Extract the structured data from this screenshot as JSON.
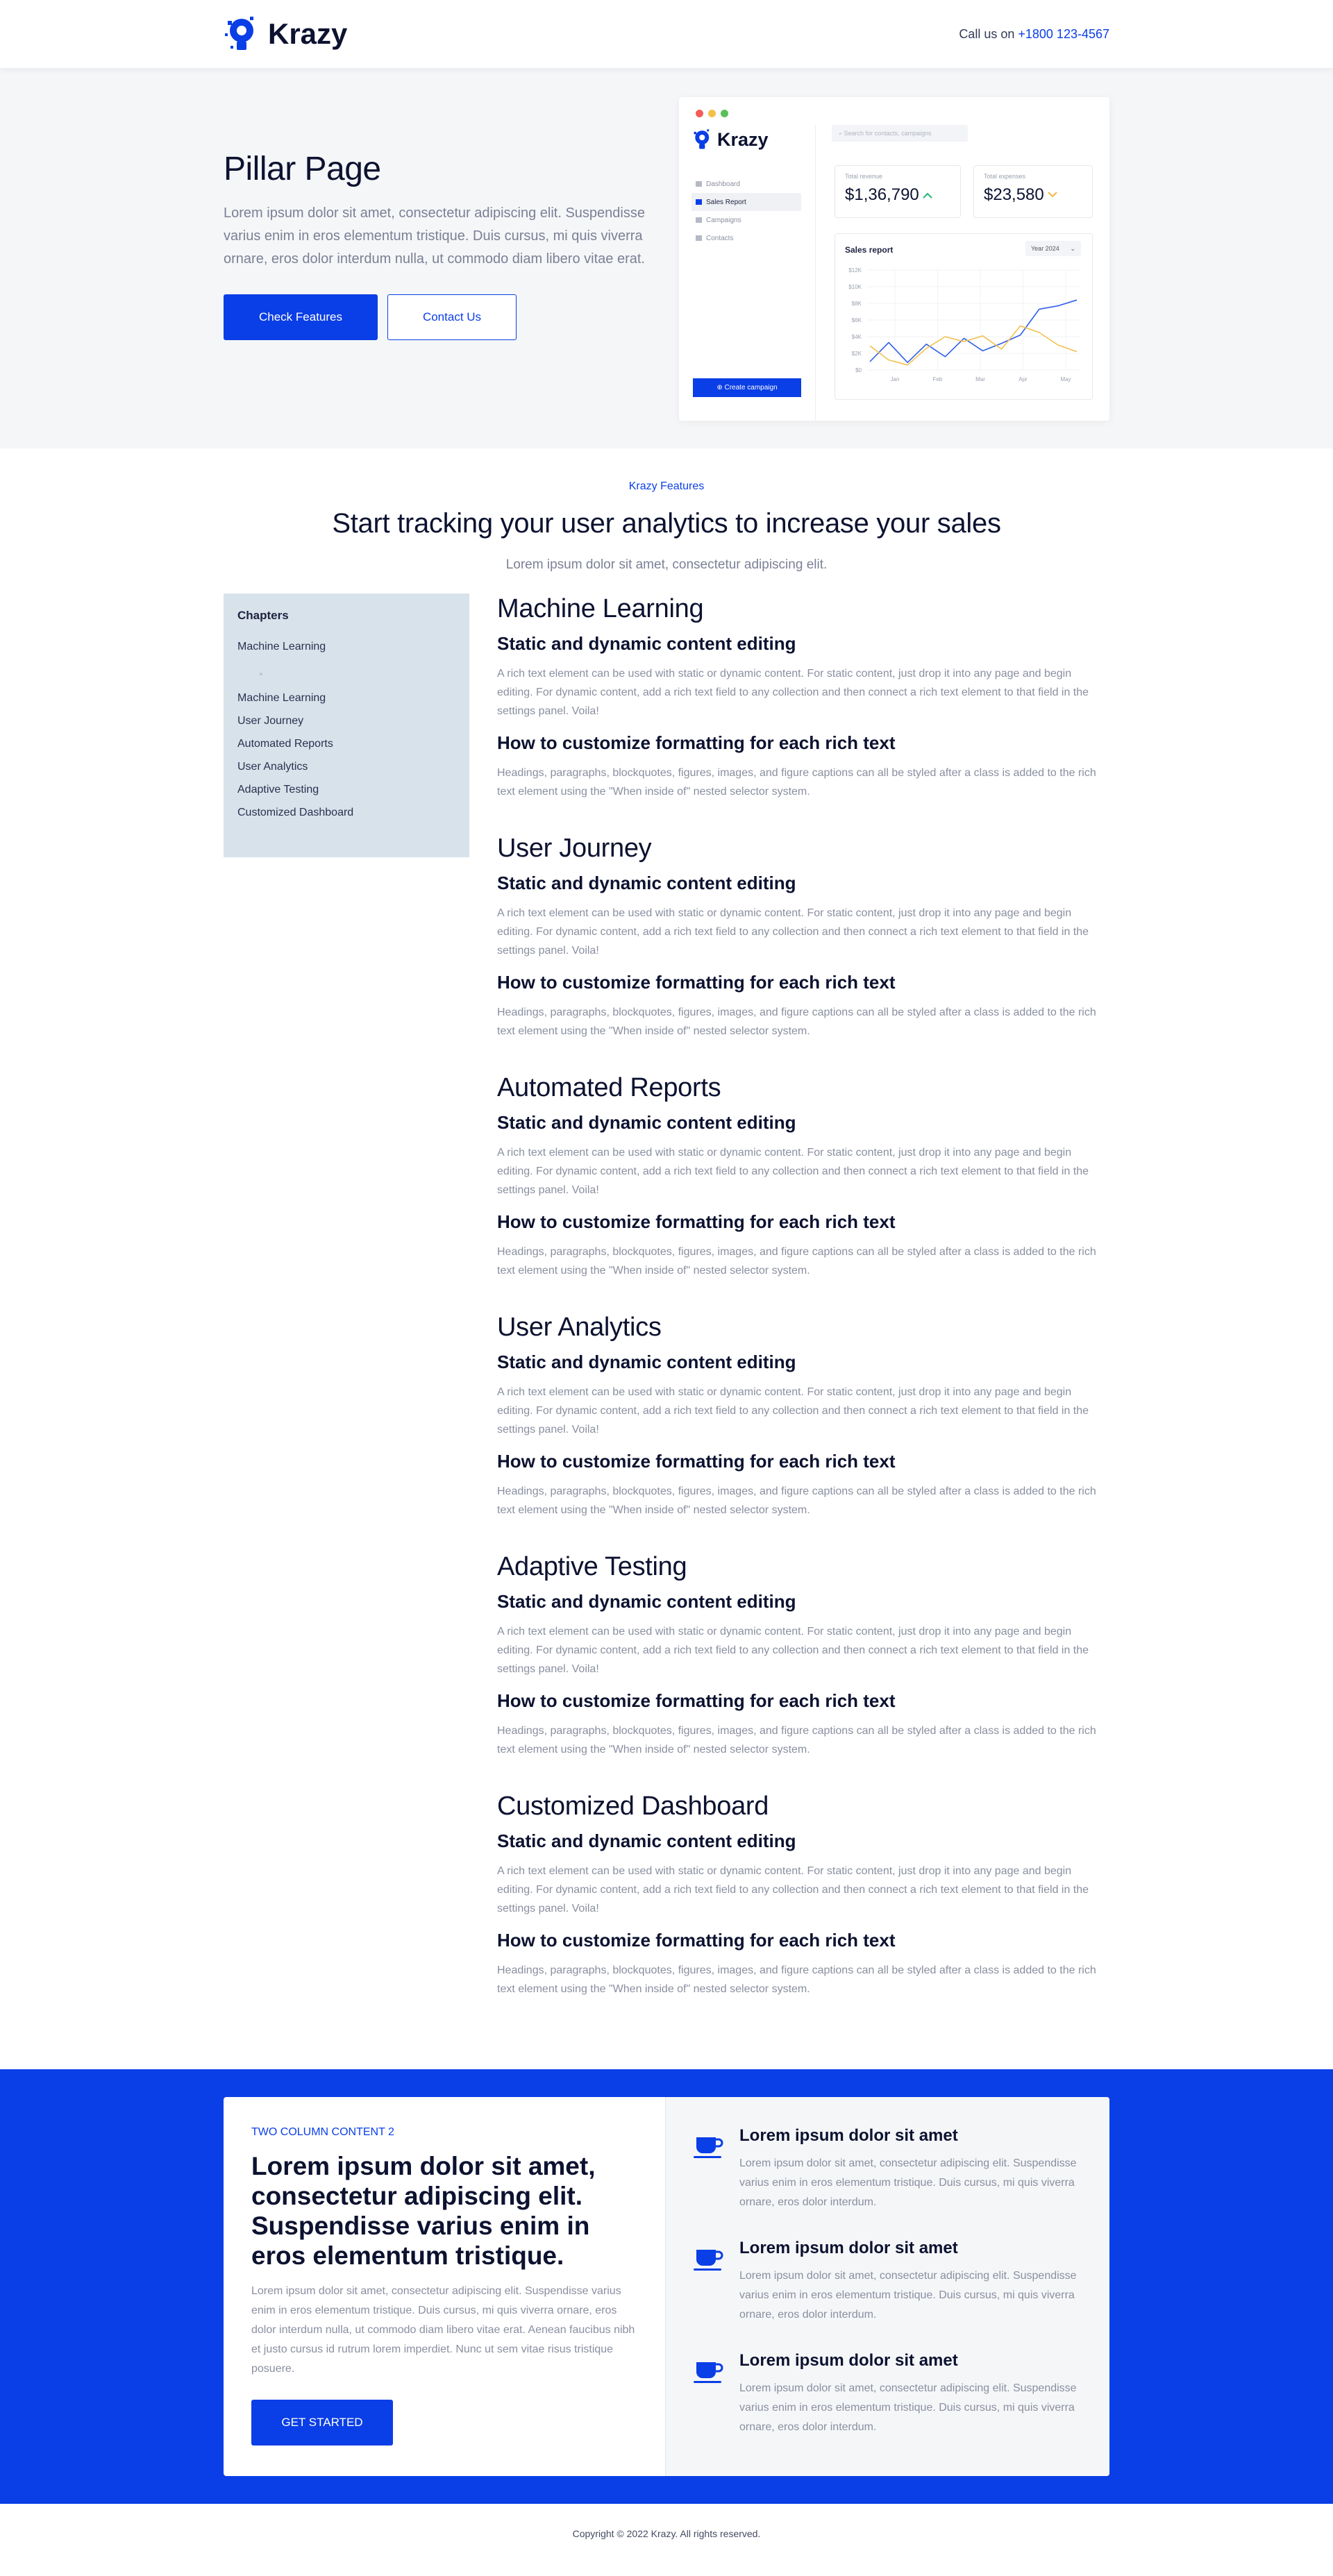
{
  "header": {
    "logo_text": "Krazy",
    "call_prefix": "Call us on",
    "phone": "+1800 123-4567"
  },
  "hero": {
    "title": "Pillar Page",
    "text": "Lorem ipsum dolor sit amet, consectetur adipiscing elit. Suspendisse varius enim in eros elementum tristique. Duis cursus, mi quis viverra ornare, eros dolor interdum nulla, ut commodo diam libero vitae erat.",
    "primary_button": "Check Features",
    "secondary_button": "Contact Us"
  },
  "dashboard_mockup": {
    "logo_text": "Krazy",
    "search_placeholder": "Search for contacts, campaigns",
    "nav": [
      {
        "label": "Dashboard",
        "active": false
      },
      {
        "label": "Sales Report",
        "active": true
      },
      {
        "label": "Campaigns",
        "active": false
      },
      {
        "label": "Contacts",
        "active": false
      }
    ],
    "cta": "Create campaign",
    "revenue_label": "Total revenue",
    "revenue_value": "$1,36,790",
    "expenses_label": "Total expenses",
    "expenses_value": "$23,580",
    "colors": {
      "up": "#22b573",
      "down": "#f2b840"
    }
  },
  "chart_data": {
    "type": "line",
    "title": "Sales report",
    "filter": "Year 2024",
    "x_labels": [
      "Jan",
      "Feb",
      "Mar",
      "Apr",
      "May"
    ],
    "y_ticks": [
      "$0",
      "$2K",
      "$4K",
      "$6K",
      "$8K",
      "$10K",
      "$12K"
    ],
    "ylim": [
      0,
      12
    ],
    "series": [
      {
        "color": "#2f5fe8",
        "values": [
          1.0,
          3.3,
          0.9,
          3.1,
          1.6,
          3.8,
          2.3,
          3.2,
          4.2,
          7.3,
          7.7,
          8.4
        ]
      },
      {
        "color": "#f2c14e",
        "values": [
          2.9,
          1.2,
          0.6,
          2.6,
          4.0,
          3.4,
          4.1,
          2.5,
          5.3,
          4.5,
          3.0,
          2.2
        ]
      }
    ]
  },
  "features": {
    "kicker": "Krazy Features",
    "title": "Start tracking your user analytics to increase your sales",
    "subtitle": "Lorem ipsum dolor sit amet, consectetur adipiscing elit."
  },
  "toc": {
    "title": "Chapters",
    "items": [
      "Machine Learning",
      "Machine Learning",
      "User Journey",
      "Automated Reports",
      "User Analytics",
      "Adaptive Testing",
      "Customized Dashboard"
    ]
  },
  "sections": [
    {
      "title": "Machine Learning",
      "h1": "Static and dynamic content editing",
      "p1": "A rich text element can be used with static or dynamic content. For static content, just drop it into any page and begin editing. For dynamic content, add a rich text field to any collection and then connect a rich text element to that field in the settings panel. Voila!",
      "h2": "How to customize formatting for each rich text",
      "p2": "Headings, paragraphs, blockquotes, figures, images, and figure captions can all be styled after a class is added to the rich text element using the \"When inside of\" nested selector system."
    },
    {
      "title": "User Journey",
      "h1": "Static and dynamic content editing",
      "p1": "A rich text element can be used with static or dynamic content. For static content, just drop it into any page and begin editing. For dynamic content, add a rich text field to any collection and then connect a rich text element to that field in the settings panel. Voila!",
      "h2": "How to customize formatting for each rich text",
      "p2": "Headings, paragraphs, blockquotes, figures, images, and figure captions can all be styled after a class is added to the rich text element using the \"When inside of\" nested selector system."
    },
    {
      "title": "Automated Reports",
      "h1": "Static and dynamic content editing",
      "p1": "A rich text element can be used with static or dynamic content. For static content, just drop it into any page and begin editing. For dynamic content, add a rich text field to any collection and then connect a rich text element to that field in the settings panel. Voila!",
      "h2": "How to customize formatting for each rich text",
      "p2": "Headings, paragraphs, blockquotes, figures, images, and figure captions can all be styled after a class is added to the rich text element using the \"When inside of\" nested selector system."
    },
    {
      "title": "User Analytics",
      "h1": "Static and dynamic content editing",
      "p1": "A rich text element can be used with static or dynamic content. For static content, just drop it into any page and begin editing. For dynamic content, add a rich text field to any collection and then connect a rich text element to that field in the settings panel. Voila!",
      "h2": "How to customize formatting for each rich text",
      "p2": "Headings, paragraphs, blockquotes, figures, images, and figure captions can all be styled after a class is added to the rich text element using the \"When inside of\" nested selector system."
    },
    {
      "title": "Adaptive Testing",
      "h1": "Static and dynamic content editing",
      "p1": "A rich text element can be used with static or dynamic content. For static content, just drop it into any page and begin editing. For dynamic content, add a rich text field to any collection and then connect a rich text element to that field in the settings panel. Voila!",
      "h2": "How to customize formatting for each rich text",
      "p2": "Headings, paragraphs, blockquotes, figures, images, and figure captions can all be styled after a class is added to the rich text element using the \"When inside of\" nested selector system."
    },
    {
      "title": "Customized Dashboard",
      "h1": "Static and dynamic content editing",
      "p1": "A rich text element can be used with static or dynamic content. For static content, just drop it into any page and begin editing. For dynamic content, add a rich text field to any collection and then connect a rich text element to that field in the settings panel. Voila!",
      "h2": "How to customize formatting for each rich text",
      "p2": "Headings, paragraphs, blockquotes, figures, images, and figure captions can all be styled after a class is added to the rich text element using the \"When inside of\" nested selector system."
    }
  ],
  "two_column": {
    "tag": "TWO COLUMN CONTENT 2",
    "title": "Lorem ipsum dolor sit amet, consectetur adipiscing elit. Suspendisse varius enim in eros elementum tristique.",
    "text": "Lorem ipsum dolor sit amet, consectetur adipiscing elit. Suspendisse varius enim in eros elementum tristique. Duis cursus, mi quis viverra ornare, eros dolor interdum nulla, ut commodo diam libero vitae erat. Aenean faucibus nibh et justo cursus id rutrum lorem imperdiet. Nunc ut sem vitae risus tristique posuere.",
    "button": "GET STARTED",
    "features": [
      {
        "icon": "cup-icon",
        "title": "Lorem ipsum dolor sit amet",
        "text": "Lorem ipsum dolor sit amet, consectetur adipiscing elit. Suspendisse varius enim in eros elementum tristique. Duis cursus, mi quis viverra ornare, eros dolor interdum."
      },
      {
        "icon": "cup-icon",
        "title": "Lorem ipsum dolor sit amet",
        "text": "Lorem ipsum dolor sit amet, consectetur adipiscing elit. Suspendisse varius enim in eros elementum tristique. Duis cursus, mi quis viverra ornare, eros dolor interdum."
      },
      {
        "icon": "cup-icon",
        "title": "Lorem ipsum dolor sit amet",
        "text": "Lorem ipsum dolor sit amet, consectetur adipiscing elit. Suspendisse varius enim in eros elementum tristique. Duis cursus, mi quis viverra ornare, eros dolor interdum."
      }
    ]
  },
  "footer": {
    "copyright": "Copyright © 2022 Krazy. All rights reserved."
  },
  "colors": {
    "brand": "#0a3ee6",
    "toc_bg": "#d8e2ea",
    "hero_bg": "#f5f6f8"
  }
}
